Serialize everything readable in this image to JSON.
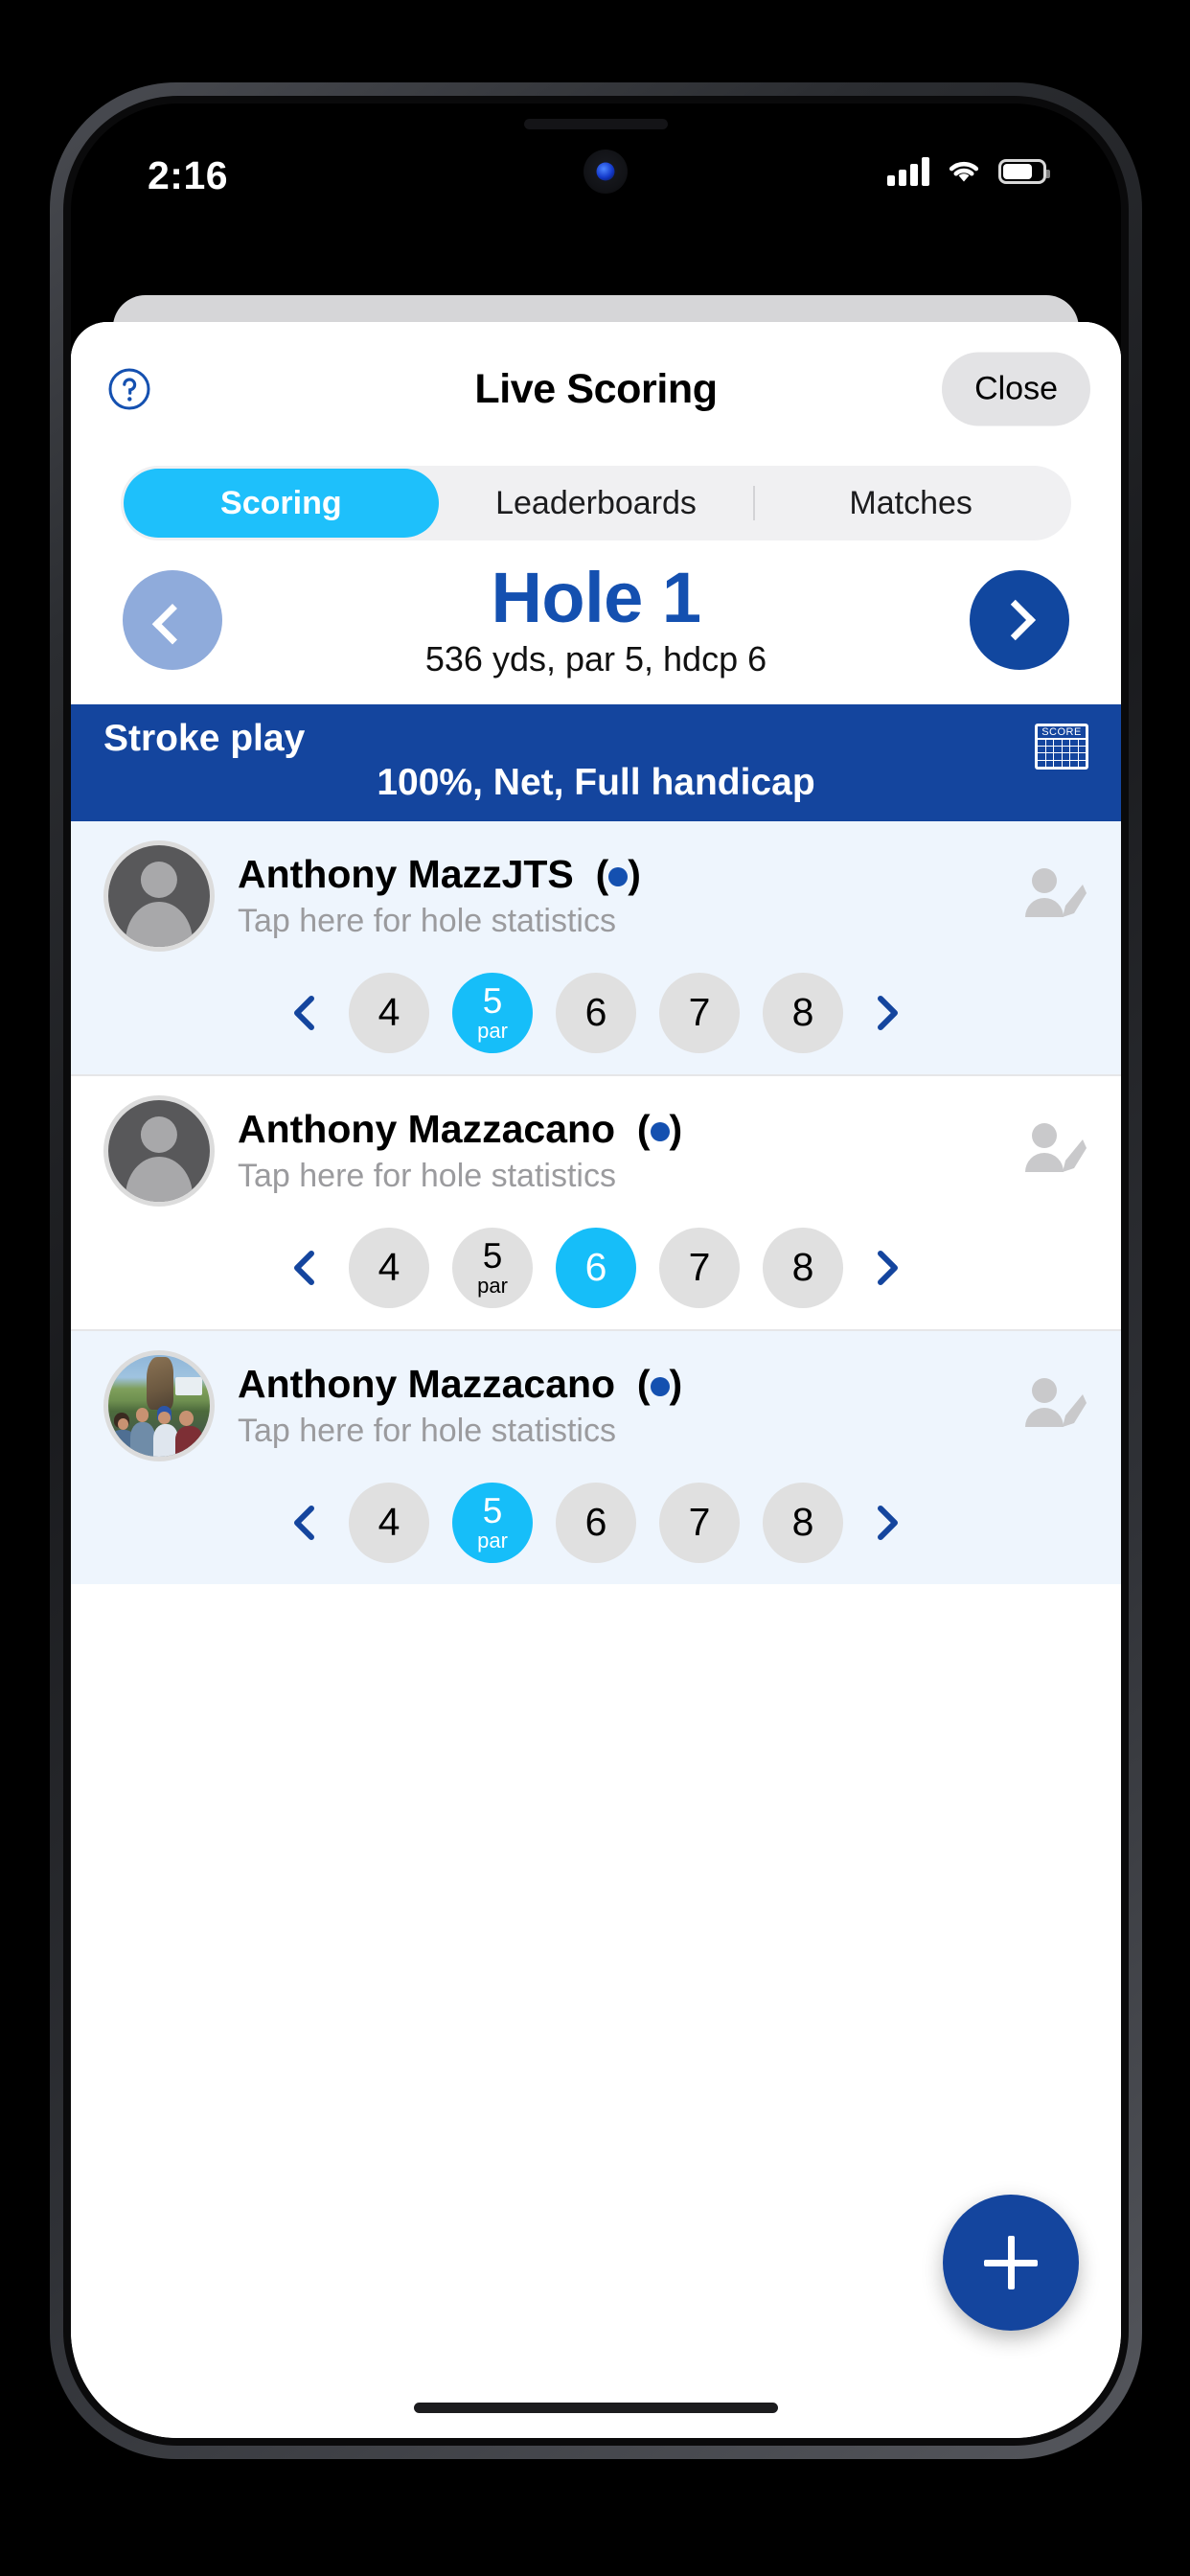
{
  "status_bar": {
    "time": "2:16",
    "signal_icon": "cellular-signal-icon",
    "wifi_icon": "wifi-icon",
    "battery_icon": "battery-icon"
  },
  "header": {
    "help_icon": "help-circle-icon",
    "title": "Live Scoring",
    "close_label": "Close"
  },
  "tabs": [
    {
      "label": "Scoring",
      "active": true
    },
    {
      "label": "Leaderboards",
      "active": false
    },
    {
      "label": "Matches",
      "active": false
    }
  ],
  "hole_nav": {
    "prev_icon": "chevron-left-icon",
    "next_icon": "chevron-right-icon",
    "hole_title": "Hole 1",
    "hole_details": "536 yds, par 5, hdcp 6"
  },
  "format_banner": {
    "title": "Stroke play",
    "subtitle": "100%, Net, Full handicap",
    "scorecard_icon": "scorecard-icon",
    "scorecard_label": "SCORE",
    "background_color": "#14459e"
  },
  "players": [
    {
      "name": "Anthony MazzJTS",
      "tee_marker": "●",
      "subtitle": "Tap here for hole statistics",
      "avatar_type": "placeholder",
      "edit_icon": "edit-player-icon",
      "prev_icon": "chevron-left-icon",
      "next_icon": "chevron-right-icon",
      "scores": [
        {
          "value": "4",
          "par": false,
          "selected": false
        },
        {
          "value": "5",
          "par": true,
          "par_label": "par",
          "selected": true
        },
        {
          "value": "6",
          "par": false,
          "selected": false
        },
        {
          "value": "7",
          "par": false,
          "selected": false
        },
        {
          "value": "8",
          "par": false,
          "selected": false
        }
      ]
    },
    {
      "name": "Anthony Mazzacano",
      "tee_marker": "●",
      "subtitle": "Tap here for hole statistics",
      "avatar_type": "placeholder",
      "edit_icon": "edit-player-icon",
      "prev_icon": "chevron-left-icon",
      "next_icon": "chevron-right-icon",
      "scores": [
        {
          "value": "4",
          "par": false,
          "selected": false
        },
        {
          "value": "5",
          "par": true,
          "par_label": "par",
          "selected": false
        },
        {
          "value": "6",
          "par": false,
          "selected": true
        },
        {
          "value": "7",
          "par": false,
          "selected": false
        },
        {
          "value": "8",
          "par": false,
          "selected": false
        }
      ]
    },
    {
      "name": "Anthony Mazzacano",
      "tee_marker": "●",
      "subtitle": "Tap here for hole statistics",
      "avatar_type": "photo",
      "edit_icon": "edit-player-icon",
      "prev_icon": "chevron-left-icon",
      "next_icon": "chevron-right-icon",
      "scores": [
        {
          "value": "4",
          "par": false,
          "selected": false
        },
        {
          "value": "5",
          "par": true,
          "par_label": "par",
          "selected": true
        },
        {
          "value": "6",
          "par": false,
          "selected": false
        },
        {
          "value": "7",
          "par": false,
          "selected": false
        },
        {
          "value": "8",
          "par": false,
          "selected": false
        }
      ]
    }
  ],
  "fab": {
    "icon": "plus-icon"
  },
  "colors": {
    "accent_cyan": "#16bef9",
    "brand_blue": "#14459e",
    "hole_blue": "#1450b0",
    "row_tint": "#eef5fd"
  }
}
